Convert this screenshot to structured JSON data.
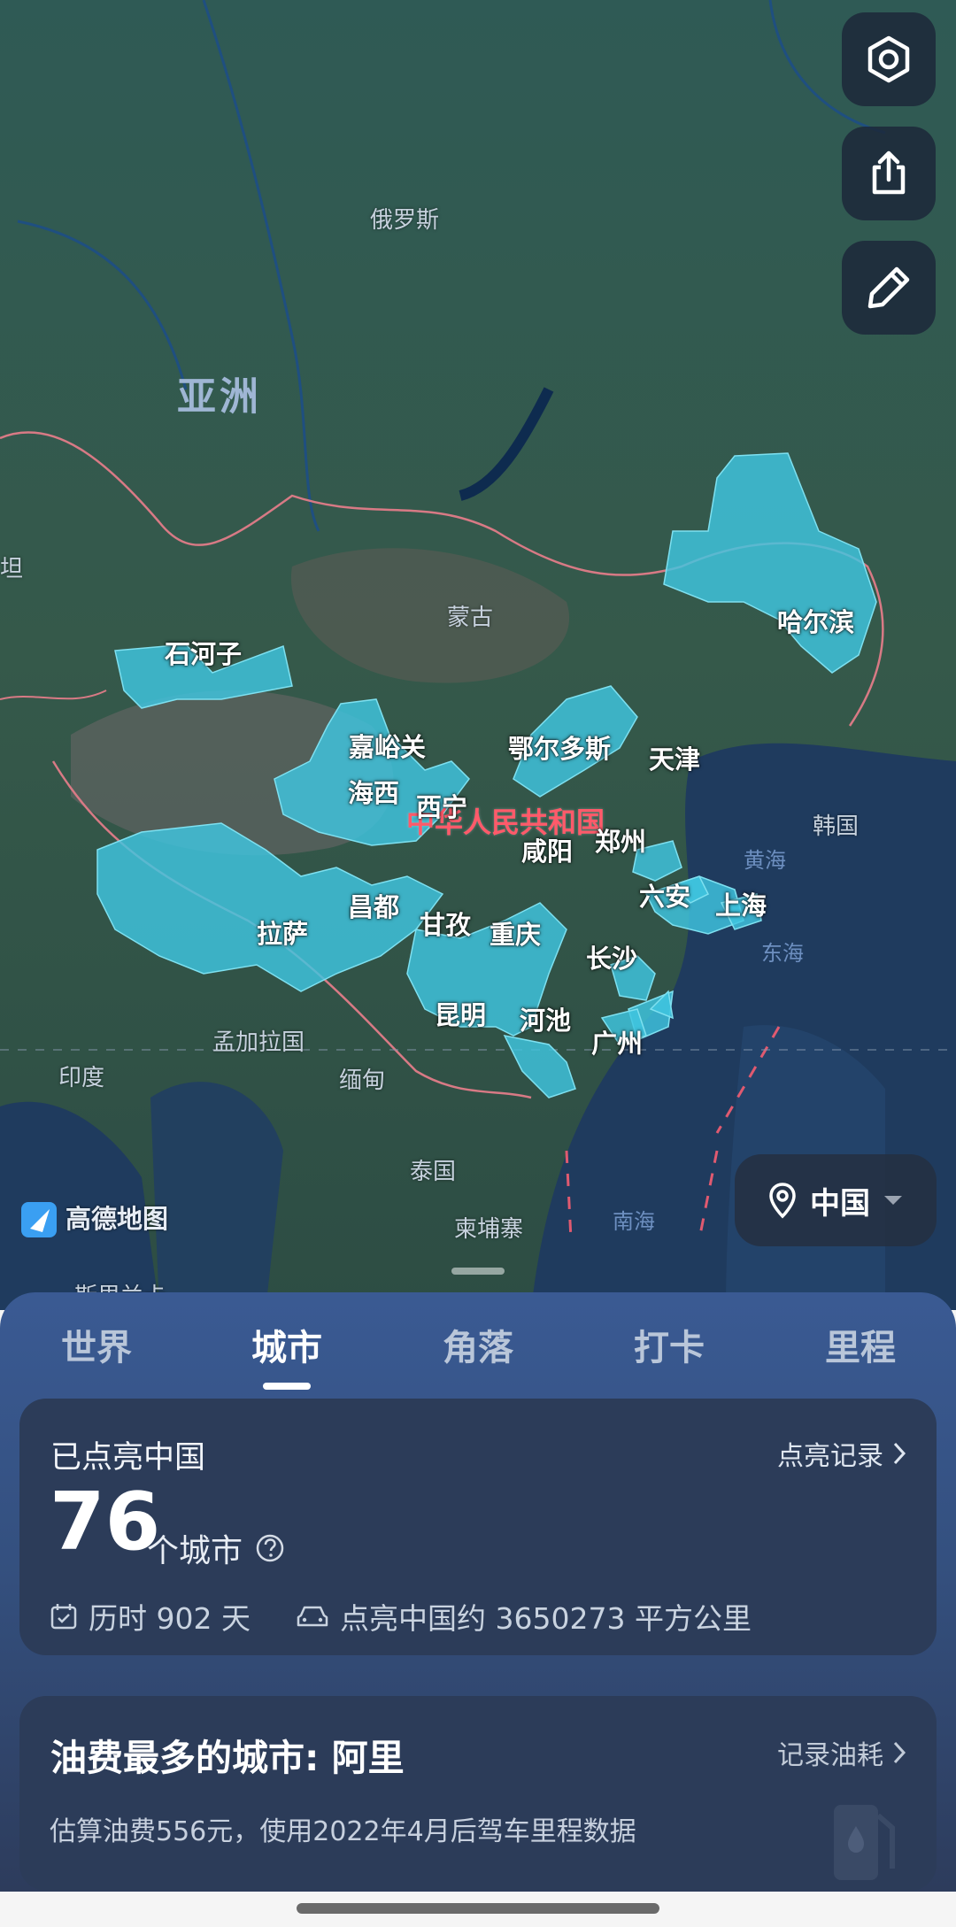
{
  "map": {
    "labels": {
      "russia": "俄罗斯",
      "asia": "亚洲",
      "mongolia": "蒙古",
      "china_name": "中华人民共和国",
      "korea": "韩国",
      "yellow_sea": "黄海",
      "east_sea": "东海",
      "south_sea": "南海",
      "bangladesh": "孟加拉国",
      "india": "印度",
      "myanmar": "缅甸",
      "thailand": "泰国",
      "cambodia": "柬埔寨",
      "partial_left": "坦",
      "partial_bottom": "斯里兰卡"
    },
    "cities": {
      "shihezi": "石河子",
      "haerbin": "哈尔滨",
      "jiayuguan": "嘉峪关",
      "eerduosi": "鄂尔多斯",
      "tianjin": "天津",
      "haixi": "海西",
      "xining": "西宁",
      "xianyang": "咸阳",
      "zhengzhou": "郑州",
      "liuan": "六安",
      "shanghai": "上海",
      "changdu": "昌都",
      "ganzi": "甘孜",
      "lasa": "拉萨",
      "chongqing": "重庆",
      "changsha": "长沙",
      "kunming": "昆明",
      "hechi": "河池",
      "guangzhou": "广州"
    },
    "logo_text": "高德地图",
    "region_selector": "中国",
    "accent_color": "#3fc6e0"
  },
  "tabs": [
    "世界",
    "城市",
    "角落",
    "打卡",
    "里程"
  ],
  "active_tab": "城市",
  "summary": {
    "title": "已点亮中国",
    "record_link": "点亮记录",
    "count": "76",
    "unit": "个城市",
    "help_icon": "question-circle-icon",
    "days": "历时 902 天",
    "area": "点亮中国约 3650273 平方公里"
  },
  "fuel": {
    "title": "油费最多的城市: 阿里",
    "link": "记录油耗",
    "desc": "估算油费556元，使用2022年4月后驾车里程数据",
    "icon": "fuel-pump-icon"
  },
  "toolbar": {
    "settings_icon": "settings-icon",
    "share_icon": "share-icon",
    "edit_icon": "edit-icon"
  }
}
